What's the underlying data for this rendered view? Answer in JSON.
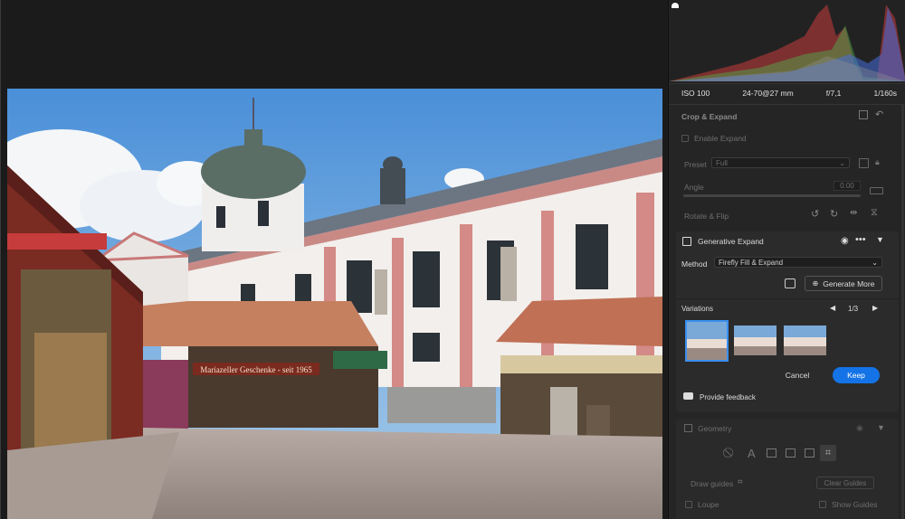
{
  "exif": {
    "iso": "ISO 100",
    "lens": "24-70@27 mm",
    "aperture": "f/7,1",
    "shutter": "1/160s"
  },
  "crop": {
    "title": "Crop & Expand",
    "enable_expand": "Enable Expand",
    "preset_label": "Preset",
    "preset_value": "Full",
    "angle_label": "Angle",
    "angle_value": "0.00",
    "rotate_label": "Rotate & Flip"
  },
  "generative_expand": {
    "title": "Generative Expand",
    "method_label": "Method",
    "method_value": "Firefly Fill & Expand",
    "generate_more": "Generate More",
    "variations_label": "Variations",
    "page_indicator": "1/3",
    "cancel": "Cancel",
    "keep": "Keep",
    "feedback": "Provide feedback"
  },
  "geometry": {
    "title": "Geometry",
    "draw_guides": "Draw guides",
    "clear_guides": "Clear Guides",
    "loupe": "Loupe",
    "show_guides": "Show Guides"
  },
  "photo": {
    "shop_sign": "Mariazeller Geschenke - seit 1965"
  },
  "colors": {
    "accent": "#1473e6",
    "panel": "#252525",
    "canvas": "#1b1b1b"
  }
}
